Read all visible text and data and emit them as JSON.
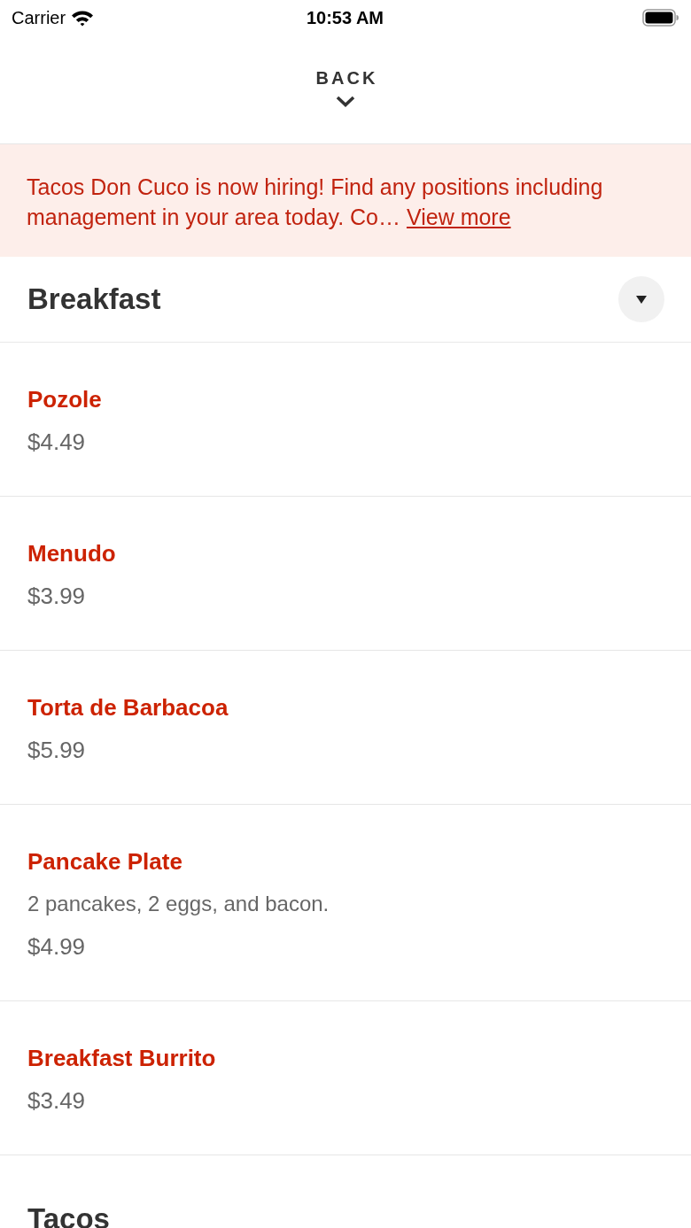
{
  "status_bar": {
    "carrier": "Carrier",
    "time": "10:53 AM"
  },
  "header": {
    "back_label": "BACK"
  },
  "banner": {
    "message": "Tacos Don Cuco is now hiring! Find any positions including management in your area today. Co…",
    "link": "View more"
  },
  "sections": [
    {
      "title": "Breakfast",
      "toggle": true,
      "items": [
        {
          "name": "Pozole",
          "price": "$4.49"
        },
        {
          "name": "Menudo",
          "price": "$3.99"
        },
        {
          "name": "Torta de Barbacoa",
          "price": "$5.99"
        },
        {
          "name": "Pancake Plate",
          "description": "2 pancakes, 2 eggs, and bacon.",
          "price": "$4.99"
        },
        {
          "name": "Breakfast Burrito",
          "price": "$3.49"
        }
      ]
    },
    {
      "title": "Tacos",
      "toggle": false
    }
  ]
}
